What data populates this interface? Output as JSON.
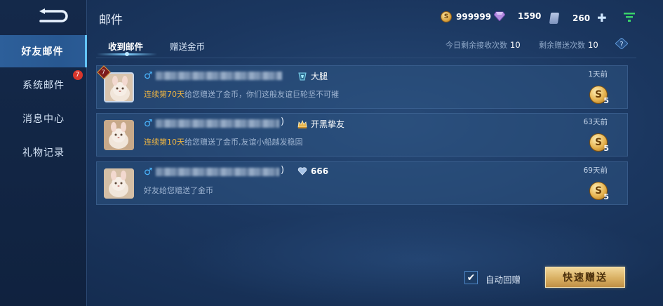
{
  "sidebar": {
    "items": [
      {
        "label": "好友邮件",
        "active": true
      },
      {
        "label": "系统邮件",
        "badge": "7"
      },
      {
        "label": "消息中心"
      },
      {
        "label": "礼物记录"
      }
    ]
  },
  "header": {
    "title": "邮件",
    "gold": "999999",
    "gems": "1590",
    "tickets": "260"
  },
  "tabs": [
    {
      "label": "收到邮件",
      "active": true
    },
    {
      "label": "赠送金币"
    }
  ],
  "counters": {
    "receive_label": "今日剩余接收次数",
    "receive_value": "10",
    "send_label": "剩余赠送次数",
    "send_value": "10"
  },
  "mails": [
    {
      "level": "7",
      "relation": "大腿",
      "message_prefix": "连续第70天",
      "message_rest": "给您赠送了金币，你们这般友谊巨轮坚不可摧",
      "time": "1天前",
      "reward": "5"
    },
    {
      "paren": ")",
      "relation": "开黑挚友",
      "message_prefix": "连续第10天",
      "message_rest": "给您赠送了金币,友谊小船越发稳固",
      "time": "63天前",
      "reward": "5"
    },
    {
      "paren": ")",
      "relation": "666",
      "message_prefix": "",
      "message_rest": "好友给您赠送了金币",
      "time": "69天前",
      "reward": "5"
    }
  ],
  "footer": {
    "auto_reply_label": "自动回赠",
    "auto_reply_checked": true,
    "quick_send_label": "快速赠送"
  },
  "colors": {
    "accent_gold": "#f0b642",
    "gender_male": "#4bb6ff",
    "button_gold": "#d9b063"
  }
}
